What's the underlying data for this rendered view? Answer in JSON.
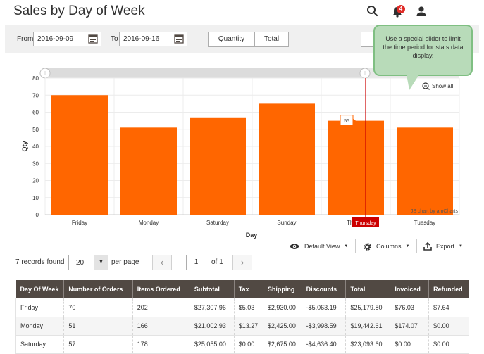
{
  "header": {
    "title": "Sales by Day of Week",
    "notification_count": "4"
  },
  "filters": {
    "from_label": "From",
    "from_value": "2016-09-09",
    "to_label": "To",
    "to_value": "2016-09-16",
    "switch_quantity": "Quantity",
    "switch_total": "Total"
  },
  "tooltip": {
    "text": "Use a special slider to limit the time period for stats data display."
  },
  "chart_data": {
    "type": "bar",
    "categories": [
      "Friday",
      "Monday",
      "Saturday",
      "Sunday",
      "Thursday",
      "Tuesday"
    ],
    "values": [
      70,
      51,
      57,
      65,
      55,
      51
    ],
    "xlabel": "Day",
    "ylabel": "Qty",
    "ylim": [
      0,
      80
    ],
    "yticks": [
      0,
      10,
      20,
      30,
      40,
      50,
      60,
      70,
      80
    ],
    "bar_color": "#ff6600",
    "hover_category": "Thursday",
    "hover_value_label": "55",
    "hover_category_label": "Thursday",
    "cursor_color": "#cc0000",
    "show_all_label": "Show all",
    "credit": "JS chart by amCharts",
    "grid": true
  },
  "grid_controls": {
    "records_found": "7 records found",
    "per_page_value": "20",
    "per_page_label": "per page",
    "prev_symbol": "‹",
    "next_symbol": "›",
    "current_page": "1",
    "of_pages": "of 1",
    "view_label": "Default View",
    "columns_label": "Columns",
    "export_label": "Export"
  },
  "table": {
    "columns": [
      "Day Of Week",
      "Number of Orders",
      "Items Ordered",
      "Subtotal",
      "Tax",
      "Shipping",
      "Discounts",
      "Total",
      "Invoiced",
      "Refunded"
    ],
    "rows": [
      [
        "Friday",
        "70",
        "202",
        "$27,307.96",
        "$5.03",
        "$2,930.00",
        "-$5,063.19",
        "$25,179.80",
        "$76.03",
        "$7.64"
      ],
      [
        "Monday",
        "51",
        "166",
        "$21,002.93",
        "$13.27",
        "$2,425.00",
        "-$3,998.59",
        "$19,442.61",
        "$174.07",
        "$0.00"
      ],
      [
        "Saturday",
        "57",
        "178",
        "$25,055.00",
        "$0.00",
        "$2,675.00",
        "-$4,636.40",
        "$23,093.60",
        "$0.00",
        "$0.00"
      ]
    ]
  }
}
